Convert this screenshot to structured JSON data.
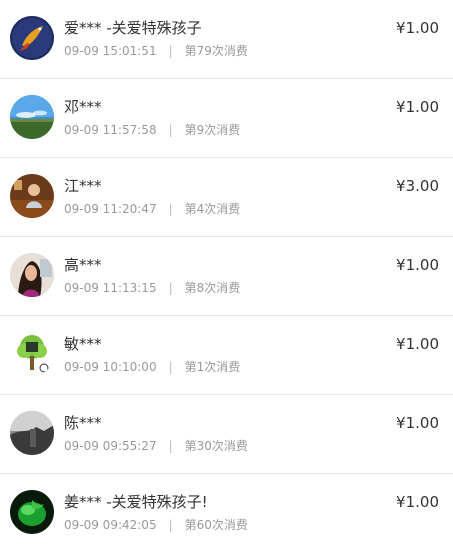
{
  "consumption_list": {
    "items": [
      {
        "name": "爱*** -关爱特殊孩子",
        "time": "09-09 15:01:51",
        "count": "第79次消费",
        "amount": "¥1.00",
        "avatar_icon": "koi-fish-avatar"
      },
      {
        "name": "邓***",
        "time": "09-09 11:57:58",
        "count": "第9次消费",
        "amount": "¥1.00",
        "avatar_icon": "sky-landscape-avatar"
      },
      {
        "name": "江***",
        "time": "09-09 11:20:47",
        "count": "第4次消费",
        "amount": "¥3.00",
        "avatar_icon": "person-photo-avatar"
      },
      {
        "name": "高***",
        "time": "09-09 11:13:15",
        "count": "第8次消费",
        "amount": "¥1.00",
        "avatar_icon": "woman-photo-avatar"
      },
      {
        "name": "敏***",
        "time": "09-09 10:10:00",
        "count": "第1次消费",
        "amount": "¥1.00",
        "avatar_icon": "green-tree-avatar"
      },
      {
        "name": "陈***",
        "time": "09-09 09:55:27",
        "count": "第30次消费",
        "amount": "¥1.00",
        "avatar_icon": "grayscale-photo-avatar"
      },
      {
        "name": "姜*** -关爱特殊孩子!",
        "time": "09-09 09:42:05",
        "count": "第60次消费",
        "amount": "¥1.00",
        "avatar_icon": "green-leaf-avatar"
      }
    ]
  }
}
